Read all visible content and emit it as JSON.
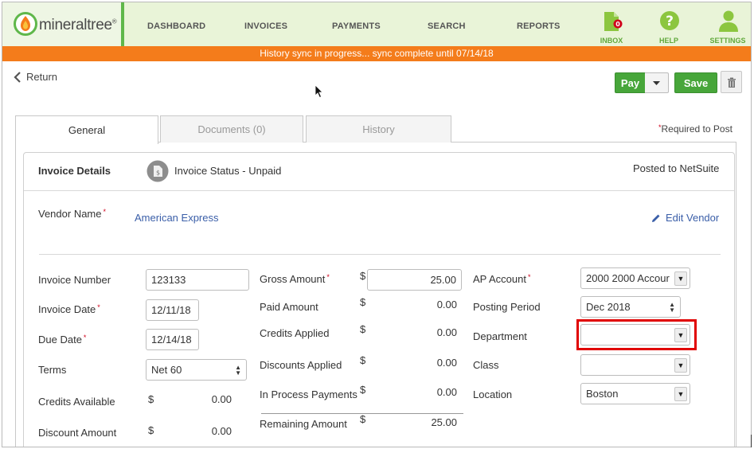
{
  "brand": {
    "name": "mineraltree",
    "tm": "®",
    "accent": "#5fb74a",
    "alert": "#f47c1b"
  },
  "nav": {
    "items": [
      "DASHBOARD",
      "INVOICES",
      "PAYMENTS",
      "SEARCH",
      "REPORTS"
    ],
    "inbox": {
      "label": "INBOX",
      "badge": "0"
    },
    "help": "HELP",
    "settings": "SETTINGS"
  },
  "sync_message": "History sync in progress... sync complete until 07/14/18",
  "toolbar": {
    "return_label": "Return",
    "pay_label": "Pay",
    "save_label": "Save"
  },
  "tabs": [
    "General",
    "Documents (0)",
    "History"
  ],
  "required_note": "Required to Post",
  "invoice": {
    "details_title": "Invoice Details",
    "status_label": "Invoice Status - Unpaid",
    "posted_label": "Posted to NetSuite",
    "vendor_label": "Vendor Name",
    "vendor_value": "American Express",
    "edit_vendor": "Edit Vendor"
  },
  "left_col": {
    "invoice_number_label": "Invoice Number",
    "invoice_number": "123133",
    "invoice_date_label": "Invoice Date",
    "invoice_date": "12/11/18",
    "due_date_label": "Due Date",
    "due_date": "12/14/18",
    "terms_label": "Terms",
    "terms": "Net 60",
    "credits_available_label": "Credits Available",
    "credits_available": "0.00",
    "discount_amount_label": "Discount Amount",
    "discount_amount": "0.00"
  },
  "mid_col": {
    "currency": "$",
    "gross_amount_label": "Gross Amount",
    "gross_amount": "25.00",
    "paid_amount_label": "Paid Amount",
    "paid_amount": "0.00",
    "credits_applied_label": "Credits Applied",
    "credits_applied": "0.00",
    "discounts_applied_label": "Discounts Applied",
    "discounts_applied": "0.00",
    "in_process_label": "In Process Payments",
    "in_process": "0.00",
    "remaining_label": "Remaining Amount",
    "remaining": "25.00"
  },
  "right_col": {
    "ap_account_label": "AP Account",
    "ap_account": "2000 2000 Accour",
    "posting_period_label": "Posting Period",
    "posting_period": "Dec 2018",
    "department_label": "Department",
    "department": "",
    "class_label": "Class",
    "class_value": "",
    "location_label": "Location",
    "location": "Boston"
  }
}
